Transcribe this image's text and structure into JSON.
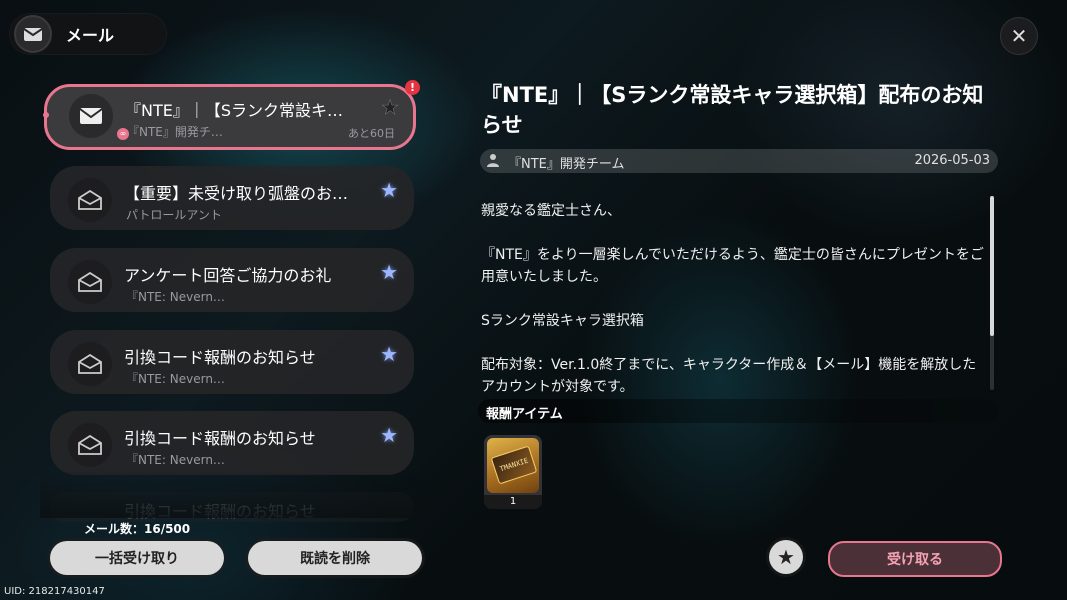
{
  "header": {
    "title": "メール",
    "icon": "envelope-icon"
  },
  "close": {
    "icon": "close-icon",
    "glyph": "✕"
  },
  "mails": [
    {
      "title": "『NTE』｜【Sランク常設キ…",
      "sender": "『NTE』開発チ…",
      "expire": "あと60日",
      "star": "★",
      "selected": true,
      "alert": "!"
    },
    {
      "title": "【重要】未受け取り弧盤のお…",
      "sender": "パトロールアント",
      "star": "★"
    },
    {
      "title": "アンケート回答ご協力のお礼",
      "sender": "『NTE: Nevern…",
      "star": "★"
    },
    {
      "title": "引換コード報酬のお知らせ",
      "sender": "『NTE: Nevern…",
      "star": "★"
    },
    {
      "title": "引換コード報酬のお知らせ",
      "sender": "『NTE: Nevern…",
      "star": "★"
    },
    {
      "title": "引換コード報酬のお知らせ"
    }
  ],
  "footer": {
    "mail_count": "メール数：16/500",
    "claim_all": "一括受け取り",
    "delete_read": "既読を削除"
  },
  "detail": {
    "title": "『NTE』｜【Sランク常設キャラ選択箱】配布のお知らせ",
    "sender": "『NTE』開発チーム",
    "date": "2026-05-03",
    "body": [
      "親愛なる鑑定士さん、",
      "『NTE』をより一層楽しんでいただけるよう、鑑定士の皆さんにプレゼントをご用意いたしました。",
      "Sランク常設キャラ選択箱",
      "配布対象：Ver.1.0終了までに、キャラクター作成＆【メール】機能を解放したアカウントが対象です。"
    ],
    "reward_label": "報酬アイテム",
    "reward_item": {
      "icon": "selection-box-item-icon",
      "card_text": "TMANXIE",
      "quantity": "1"
    },
    "favorite_glyph": "★",
    "receive": "受け取る"
  },
  "uid": "UID: 218217430147",
  "colors": {
    "accent": "#e8768f",
    "star": "#9db7ff",
    "alert": "#e5343f"
  }
}
